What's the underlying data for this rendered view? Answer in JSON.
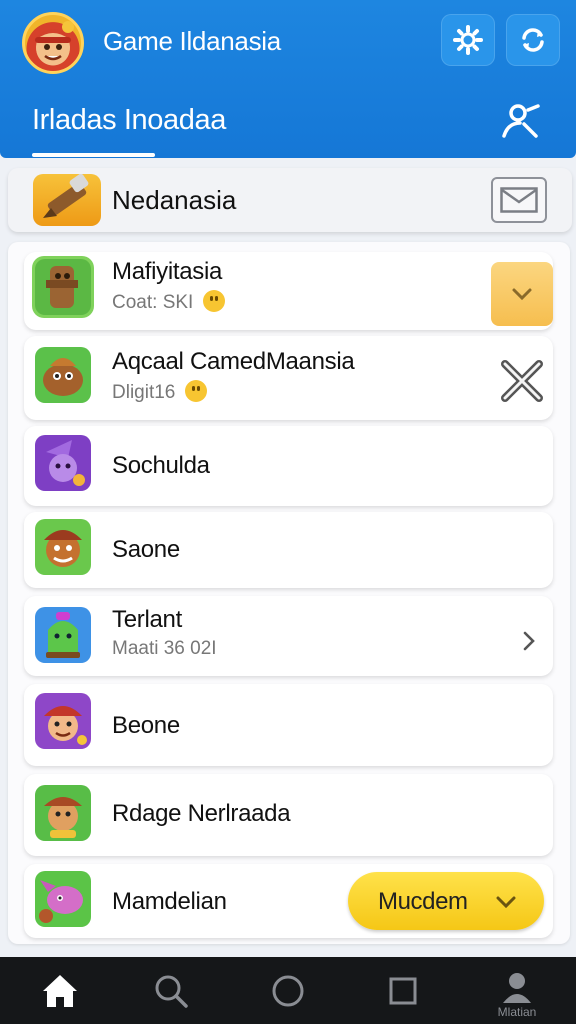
{
  "header": {
    "title": "Game Ildanasia",
    "subtitle": "Irladas Inoadaa",
    "accent_color": "#1577d6",
    "buttons": [
      "settings-icon",
      "sync-icon"
    ],
    "right_icon": "person-icon"
  },
  "banner": {
    "label": "Nedanasia",
    "icon": "crayon-icon",
    "action_icon": "mail-icon"
  },
  "list": [
    {
      "title": "Mafiyitasia",
      "subtitle": "Coat: SKI",
      "action": "chevron-down-button",
      "icon": "totem-game-icon"
    },
    {
      "title": "Aqcaal CamedMaansia",
      "subtitle": "Dligit16",
      "action": "close-button",
      "icon": "bird-game-icon"
    },
    {
      "title": "Sochulda",
      "subtitle": "",
      "action": "",
      "icon": "wizard-game-icon"
    },
    {
      "title": "Saone",
      "subtitle": "",
      "action": "",
      "icon": "hero-game-icon"
    },
    {
      "title": "Terlant",
      "subtitle": "Maati 36 02I",
      "action": "chevron-right",
      "icon": "robot-game-icon"
    },
    {
      "title": "Beone",
      "subtitle": "",
      "action": "",
      "icon": "pirate-game-icon"
    },
    {
      "title": "Rdage Nerlraada",
      "subtitle": "",
      "action": "",
      "icon": "viking-game-icon"
    },
    {
      "title": "Mamdelian",
      "subtitle": "",
      "action": "dropdown-pill",
      "icon": "fox-game-icon",
      "pill_label": "Mucdem"
    }
  ],
  "navbar": {
    "items": [
      "home-icon",
      "search-icon",
      "circle-icon",
      "square-icon",
      "profile-icon"
    ],
    "profile_label": "Mlatian"
  }
}
